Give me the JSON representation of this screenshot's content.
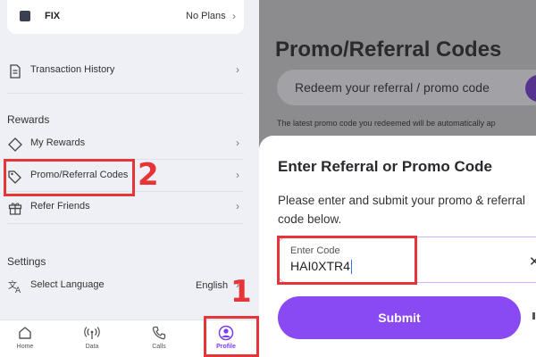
{
  "plan": {
    "name": "FIX",
    "value": "No Plans"
  },
  "menu": {
    "transaction_history": "Transaction History",
    "rewards_heading": "Rewards",
    "my_rewards": "My Rewards",
    "promo_codes": "Promo/Referral Codes",
    "refer_friends": "Refer Friends",
    "settings_heading": "Settings",
    "select_language": "Select Language",
    "language_value": "English"
  },
  "nav": {
    "home": "Home",
    "data": "Data",
    "calls": "Calls",
    "profile": "Profile",
    "active": "Profile"
  },
  "annotations": {
    "step1": "1",
    "step2": "2",
    "color": "#e53538"
  },
  "promo_page": {
    "title": "Promo/Referral Codes",
    "redeem_placeholder": "Redeem your referral / promo code",
    "note": "The latest promo code you redeemed will be automatically ap"
  },
  "dialog": {
    "title": "Enter Referral or Promo Code",
    "description": "Please enter and submit your promo & referral code below.",
    "field_label": "Enter Code",
    "field_value": "HAI0XTR4",
    "submit": "Submit"
  },
  "colors": {
    "accent": "#8a4af3",
    "active_nav": "#7b3cf5"
  },
  "icons": [
    "receipt-icon",
    "diamond-icon",
    "tag-icon",
    "gift-icon",
    "translate-icon",
    "home-icon",
    "antenna-icon",
    "phone-icon",
    "profile-icon",
    "close-icon"
  ]
}
